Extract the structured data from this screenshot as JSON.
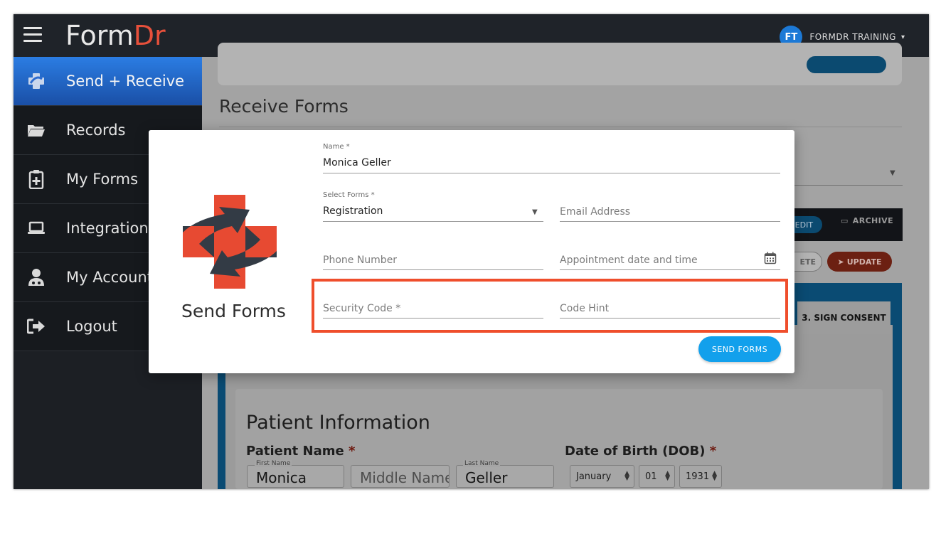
{
  "app": {
    "brand_part1": "Form",
    "brand_part2": "Dr",
    "brand_accent": "#e7503b"
  },
  "user": {
    "initials": "FT",
    "name": "FORMDR TRAINING",
    "caret": "▾"
  },
  "sidebar": {
    "items": [
      {
        "label": "Send + Receive",
        "icon": "send-receive-icon",
        "active": true
      },
      {
        "label": "Records",
        "icon": "folder-icon"
      },
      {
        "label": "My Forms",
        "icon": "clipboard-icon"
      },
      {
        "label": "Integration",
        "icon": "laptop-icon"
      },
      {
        "label": "My Account",
        "icon": "user-icon"
      },
      {
        "label": "Logout",
        "icon": "logout-icon"
      }
    ]
  },
  "background": {
    "receive_title": "Receive Forms",
    "edit_label": "EDIT",
    "archive_label": "ARCHIVE",
    "delete_label": "ETE",
    "update_label": "UPDATE",
    "sign_tab_label": "3. SIGN CONSENT",
    "patient_info_title": "Patient Information",
    "patient_name_label": "Patient Name",
    "required_mark": "*",
    "first_name_sublabel": "First Name",
    "first_name_value": "Monica",
    "middle_name_placeholder": "Middle Name",
    "last_name_sublabel": "Last Name",
    "last_name_value": "Geller",
    "dob_label": "Date of Birth (DOB)",
    "dob_month": "January",
    "dob_day": "01",
    "dob_year": "1931"
  },
  "modal": {
    "title": "Send Forms",
    "name_label": "Name *",
    "name_value": "Monica Geller",
    "select_forms_label": "Select Forms *",
    "select_forms_value": "Registration",
    "email_placeholder": "Email Address",
    "phone_placeholder": "Phone Number",
    "appointment_placeholder": "Appointment date and time",
    "security_code_placeholder": "Security Code *",
    "code_hint_placeholder": "Code Hint",
    "send_button": "SEND FORMS",
    "button_color": "#12a0ec",
    "highlight_color": "#ef4e2c"
  }
}
